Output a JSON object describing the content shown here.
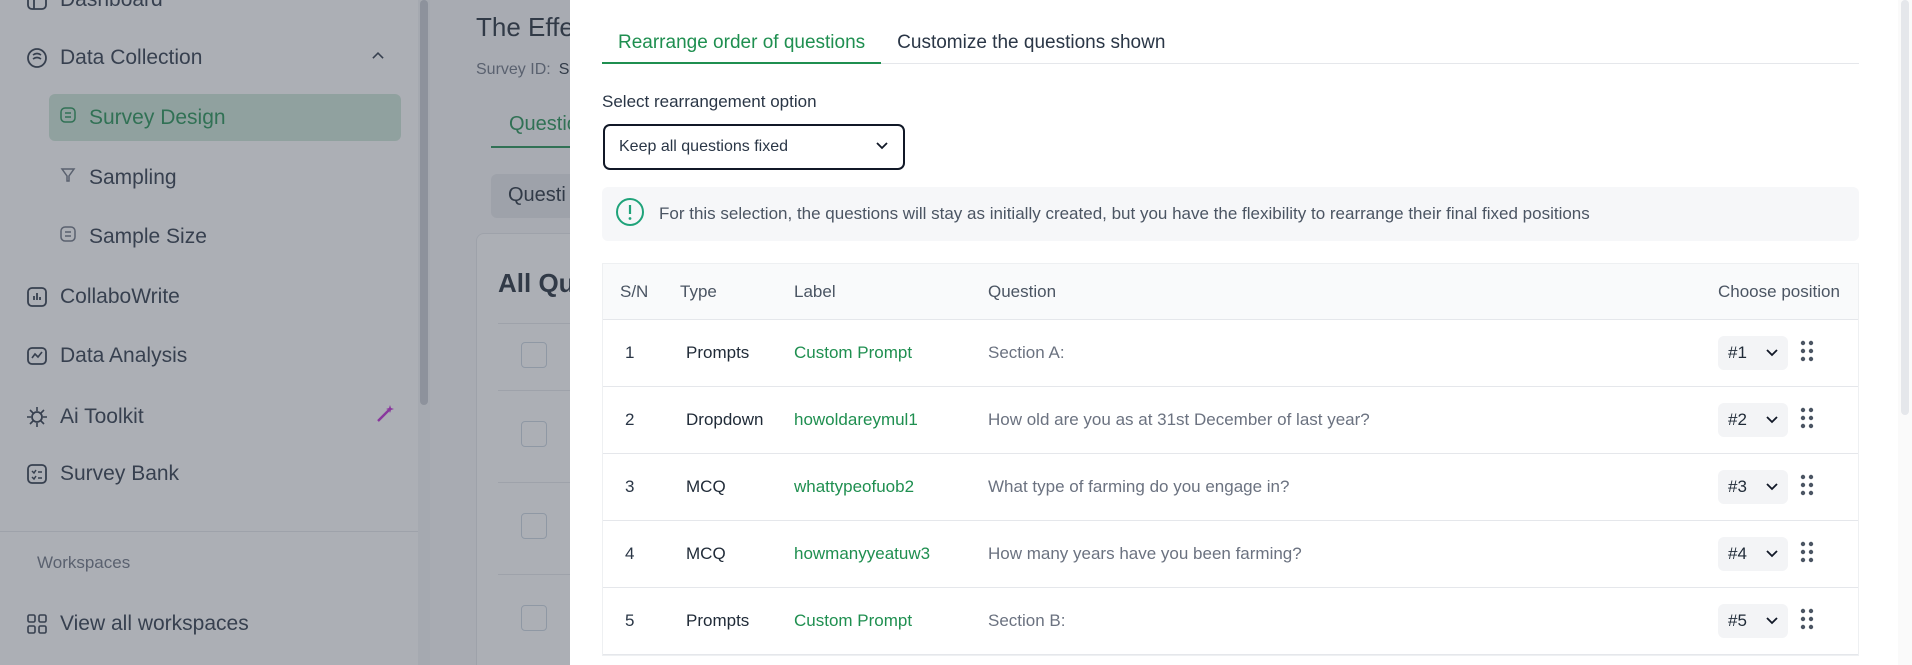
{
  "sidebar": {
    "top_item": "Dashboard",
    "data_collection": "Data Collection",
    "survey_design": "Survey Design",
    "sampling": "Sampling",
    "sample_size": "Sample Size",
    "collabowrite": "CollaboWrite",
    "data_analysis": "Data Analysis",
    "ai_toolkit": "Ai Toolkit",
    "survey_bank": "Survey Bank",
    "workspaces_title": "Workspaces",
    "view_all_workspaces": "View all workspaces"
  },
  "background": {
    "page_title": "The Effe",
    "survey_id_label": "Survey ID:",
    "survey_id_value": "S",
    "tab": "Questio",
    "button": "Questi",
    "card_title": "All Que"
  },
  "panel": {
    "tabs": [
      "Rearrange order of questions",
      "Customize the questions shown"
    ],
    "select_label": "Select rearrangement option",
    "select_value": "Keep all questions fixed",
    "info_text": "For this selection, the questions will stay as initially created, but you have the flexibility to rearrange their final fixed positions",
    "table": {
      "headers": {
        "sn": "S/N",
        "type": "Type",
        "label": "Label",
        "question": "Question",
        "position": "Choose position"
      },
      "rows": [
        {
          "sn": "1",
          "type": "Prompts",
          "label": "Custom Prompt",
          "question": "Section A:",
          "position": "#1"
        },
        {
          "sn": "2",
          "type": "Dropdown",
          "label": "howoldareymul1",
          "question": "How old are you as at 31st December of last year?",
          "position": "#2"
        },
        {
          "sn": "3",
          "type": "MCQ",
          "label": "whattypeofuob2",
          "question": "What type of farming do you engage in?",
          "position": "#3"
        },
        {
          "sn": "4",
          "type": "MCQ",
          "label": "howmanyyeatuw3",
          "question": "How many years have you been farming?",
          "position": "#4"
        },
        {
          "sn": "5",
          "type": "Prompts",
          "label": "Custom Prompt",
          "question": "Section B:",
          "position": "#5"
        }
      ]
    }
  },
  "colors": {
    "accent": "#1f8f50",
    "active_bg": "#cde6d7",
    "ai_icon": "#c026d3"
  },
  "icons": [
    "dashboard-icon",
    "data-collection-icon",
    "chevron-up-icon",
    "survey-design-icon",
    "sampling-icon",
    "sample-size-icon",
    "collabowrite-icon",
    "data-analysis-icon",
    "ai-toolkit-icon",
    "magic-wand-icon",
    "survey-bank-icon",
    "workspaces-grid-icon",
    "info-icon",
    "chevron-down-icon",
    "drag-handle-icon"
  ]
}
